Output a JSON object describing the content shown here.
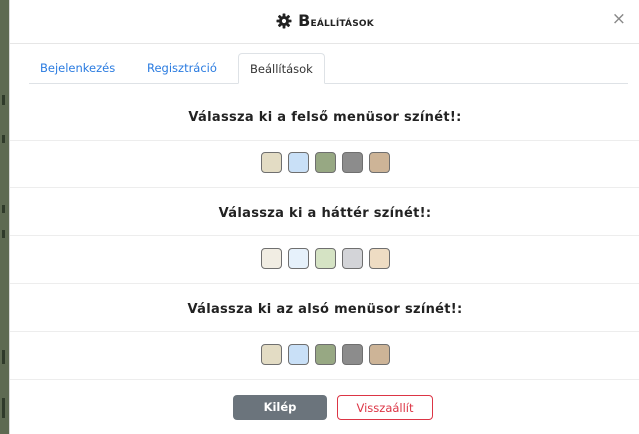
{
  "header": {
    "title_first": "B",
    "title_rest": "eállítások",
    "icon": "gear-icon",
    "close_label": "×"
  },
  "tabs": [
    {
      "label": "Bejelenkezés",
      "active": false
    },
    {
      "label": "Regisztráció",
      "active": false
    },
    {
      "label": "Beállítások",
      "active": true
    }
  ],
  "sections": [
    {
      "title": "Válassza ki a felső menüsor színét!:",
      "swatches": [
        "#e3dcc4",
        "#c9e0f7",
        "#97a883",
        "#8c8c8c",
        "#cdb497"
      ]
    },
    {
      "title": "Válassza ki a háttér színét!:",
      "swatches": [
        "#f1ede3",
        "#e6f1fb",
        "#d5e3c4",
        "#d3d4d8",
        "#eedcc3"
      ]
    },
    {
      "title": "Válassza ki az alsó menüsor színét!:",
      "swatches": [
        "#e3dcc4",
        "#c9e0f7",
        "#97a883",
        "#8c8c8c",
        "#cdb497"
      ]
    }
  ],
  "buttons": {
    "exit_label": "Kilép",
    "reset_label": "Visszaállít"
  },
  "colors": {
    "tab_link": "#2a7be0",
    "exit_button": "#6b747c",
    "reset_button": "#dc3545"
  }
}
